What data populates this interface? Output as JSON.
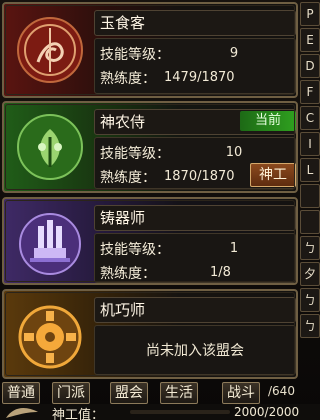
{
  "cards": [
    {
      "name": "玉食客",
      "skill_label": "技能等级：",
      "skill_level": "9",
      "prof_label": "熟练度：",
      "proficiency": "1479/1870"
    },
    {
      "name": "神农侍",
      "badge": "当前",
      "skill_label": "技能等级：",
      "skill_level": "10",
      "prof_label": "熟练度：",
      "proficiency": "1870/1870",
      "button": "神工"
    },
    {
      "name": "铸器师",
      "skill_label": "技能等级：",
      "skill_level": "1",
      "prof_label": "熟练度：",
      "proficiency": "1/8"
    },
    {
      "name": "机巧师",
      "status": "尚未加入该盟会"
    }
  ],
  "tabs": [
    "普通",
    "门派",
    "盟会",
    "生活",
    "战斗"
  ],
  "capacity": "/640",
  "footer": {
    "label": "神工值：",
    "value": "2000/2000"
  },
  "sidebar": [
    "P",
    "E",
    "D",
    "F",
    "C",
    "I",
    "L",
    "",
    "",
    "ㄅ",
    "夕",
    "ㄅ",
    "ㄅ"
  ],
  "colors": {
    "red": "#5a1410",
    "green": "#205d18",
    "purple": "#3f2a66",
    "gold": "#5b3a0c",
    "current_badge": "#2fa01f"
  },
  "icons": [
    "red-dragon-emblem-icon",
    "green-herb-emblem-icon",
    "purple-anvil-emblem-icon",
    "gold-gear-emblem-icon"
  ]
}
